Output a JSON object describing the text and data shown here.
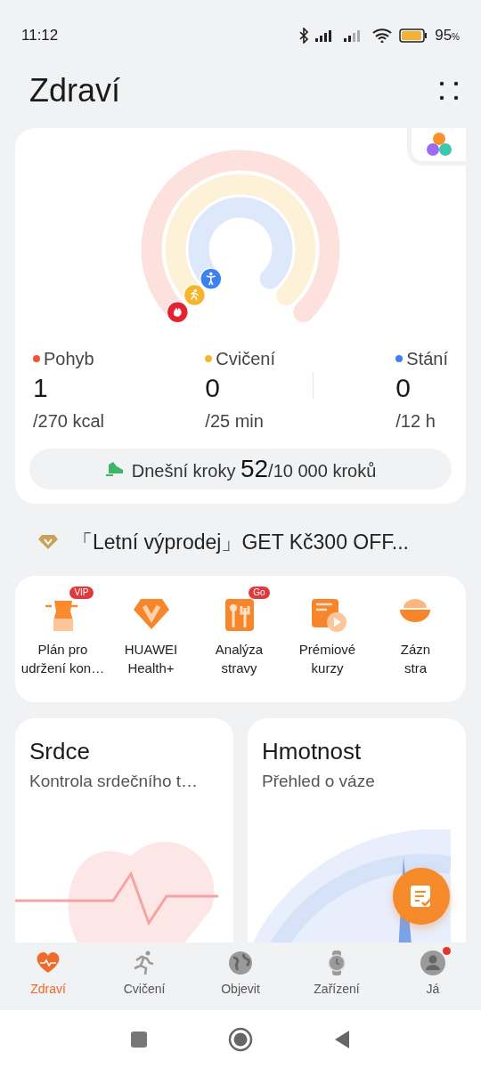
{
  "status_bar": {
    "time": "11:12",
    "battery": "95",
    "battery_unit": "%"
  },
  "header": {
    "title": "Zdraví"
  },
  "activity": {
    "rings": [
      {
        "label": "Pohyb",
        "value": "1",
        "goal": "/270 kcal",
        "color": "#f0552f"
      },
      {
        "label": "Cvičení",
        "value": "0",
        "goal": "/25 min",
        "color": "#f7b52c"
      },
      {
        "label": "Stání",
        "value": "0",
        "goal": "/12 h",
        "color": "#3b82f0"
      }
    ],
    "steps": {
      "label": "Dnešní kroky",
      "count": "52",
      "goal": "/10 000 kroků"
    }
  },
  "promo": {
    "text": "「Letní výprodej」GET Kč300 OFF..."
  },
  "shortcuts": [
    {
      "lines": [
        "Plán pro",
        "udržení kon…"
      ],
      "badge": "VIP"
    },
    {
      "lines": [
        "HUAWEI",
        "Health+"
      ]
    },
    {
      "lines": [
        "Analýza",
        "stravy"
      ],
      "badge": "Go"
    },
    {
      "lines": [
        "Prémiové",
        "kurzy"
      ]
    },
    {
      "lines": [
        "Zázn",
        "stra"
      ]
    }
  ],
  "cards": [
    {
      "title": "Srdce",
      "subtitle": "Kontrola srdečního t…",
      "kind": "heart"
    },
    {
      "title": "Hmotnost",
      "subtitle": "Přehled o váze",
      "kind": "weight"
    }
  ],
  "tabs": [
    {
      "label": "Zdraví",
      "selected": true,
      "notification": false
    },
    {
      "label": "Cvičení",
      "selected": false,
      "notification": false
    },
    {
      "label": "Objevit",
      "selected": false,
      "notification": false
    },
    {
      "label": "Zařízení",
      "selected": false,
      "notification": false
    },
    {
      "label": "Já",
      "selected": false,
      "notification": true
    }
  ]
}
